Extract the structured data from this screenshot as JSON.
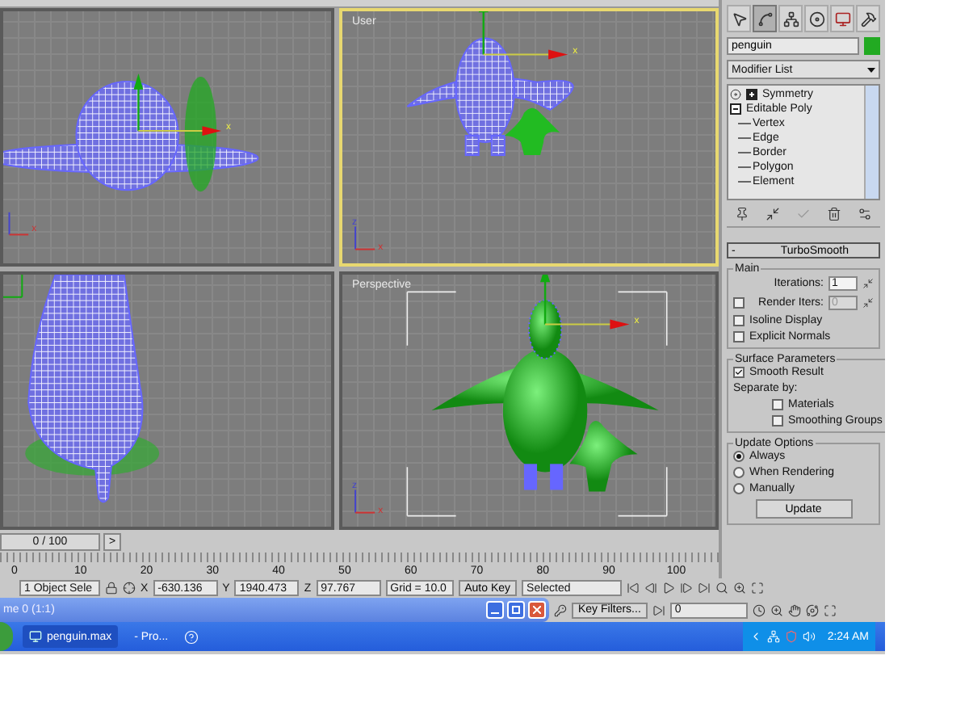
{
  "viewports": [
    {
      "kind": "front",
      "selected": false,
      "gizmo_label": "x",
      "axis_labels": [
        "x"
      ]
    },
    {
      "kind": "user",
      "label": "User",
      "selected": true,
      "gizmo_label": "x",
      "axis_labels": [
        "z",
        "x"
      ]
    },
    {
      "kind": "side",
      "selected": false
    },
    {
      "kind": "perspective",
      "label": "Perspective",
      "selected": false,
      "gizmo_label": "x",
      "axis_labels": [
        "z",
        "x"
      ]
    }
  ],
  "command_panel": {
    "tabs": [
      {
        "kind": "create",
        "selected": false
      },
      {
        "kind": "modify",
        "selected": true
      },
      {
        "kind": "hierarchy",
        "selected": false
      },
      {
        "kind": "motion",
        "selected": false
      },
      {
        "kind": "display",
        "selected": false
      },
      {
        "kind": "utilities",
        "selected": false
      }
    ],
    "object_name": "penguin",
    "modifier_list": "Modifier List",
    "stack": [
      {
        "label": "Symmetry",
        "kind": "modifier",
        "expanded": false
      },
      {
        "label": "Editable Poly",
        "kind": "base",
        "expanded": true,
        "children": [
          {
            "label": "Vertex"
          },
          {
            "label": "Edge"
          },
          {
            "label": "Border"
          },
          {
            "label": "Polygon"
          },
          {
            "label": "Element"
          }
        ]
      }
    ],
    "rollout": {
      "toggle": "-",
      "title": "TurboSmooth",
      "groups": [
        {
          "title": "Main",
          "controls": [
            {
              "kind": "spinner",
              "label": "Iterations:",
              "value": "1",
              "disabled": false
            },
            {
              "kind": "checkspinner",
              "label": "Render Iters:",
              "checked": false,
              "value": "0",
              "disabled": true
            },
            {
              "kind": "checkbox",
              "label": "Isoline Display",
              "checked": false
            },
            {
              "kind": "checkbox",
              "label": "Explicit Normals",
              "checked": false
            }
          ]
        },
        {
          "title": "Surface Parameters",
          "controls": [
            {
              "kind": "checkbox",
              "label": "Smooth Result",
              "checked": true
            },
            {
              "kind": "text",
              "label": "Separate by:",
              "children": [
                {
                  "kind": "checkbox",
                  "label": "Materials",
                  "checked": false
                },
                {
                  "kind": "checkbox",
                  "label": "Smoothing Groups",
                  "checked": false
                }
              ]
            }
          ]
        },
        {
          "title": "Update Options",
          "controls": [
            {
              "kind": "radio",
              "label": "Always",
              "selected": true
            },
            {
              "kind": "radio",
              "label": "When Rendering",
              "selected": false
            },
            {
              "kind": "radio",
              "label": "Manually",
              "selected": false
            },
            {
              "kind": "button",
              "label": "Update"
            }
          ]
        }
      ]
    }
  },
  "time_slider": {
    "label": "0 / 100",
    "next": ">"
  },
  "ruler": {
    "labels": [
      "0",
      "10",
      "20",
      "30",
      "40",
      "50",
      "60",
      "70",
      "80",
      "90",
      "100"
    ]
  },
  "status": {
    "selection": "1 Object Sele",
    "coords": [
      {
        "axis": "X",
        "value": "-630.136"
      },
      {
        "axis": "Y",
        "value": "1940.473"
      },
      {
        "axis": "Z",
        "value": "97.767"
      }
    ],
    "grid": "Grid = 10.0",
    "auto_key": "Auto Key",
    "key_mode": "Selected",
    "key_filters": "Key Filters...",
    "frame": "0"
  },
  "window_bar": {
    "title": "me 0 (1:1)"
  },
  "taskbar": {
    "tasks": [
      {
        "label": "penguin.max",
        "kind": "app"
      },
      {
        "label": "- Pro...",
        "kind": "plain"
      }
    ],
    "clock": "2:24 AM"
  }
}
